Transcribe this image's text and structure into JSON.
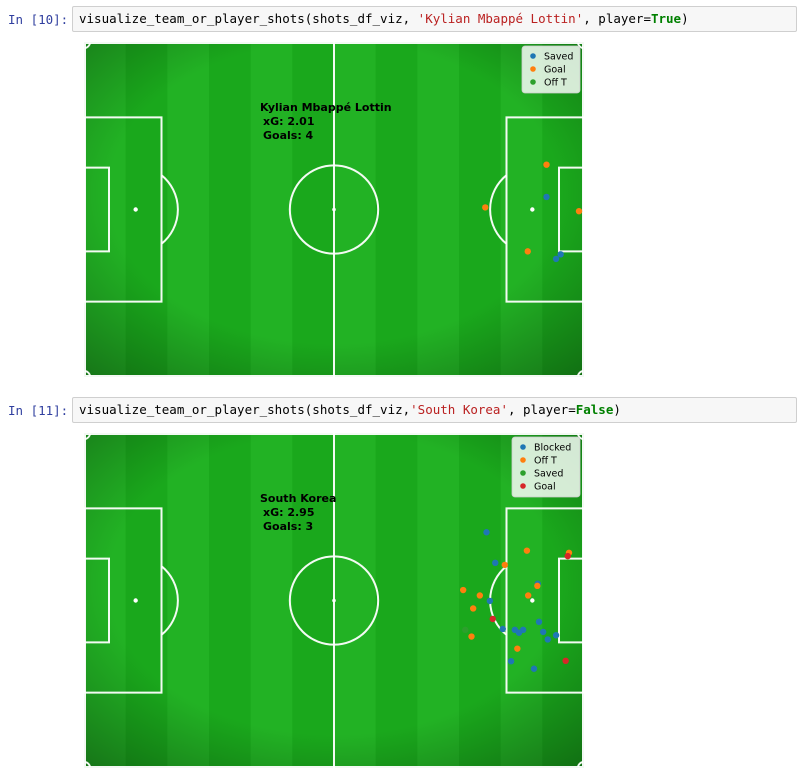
{
  "cells": [
    {
      "prompt": "In [10]:",
      "code": {
        "fn": "visualize_team_or_player_shots",
        "open": "(shots_df_viz, ",
        "arg_str": "'Kylian Mbappé Lottin'",
        "mid": ", player=",
        "kw": "True",
        "close": ")"
      },
      "annotation": {
        "name": "Kylian Mbappé Lottin",
        "xg": "xG: 2.01",
        "goals": "Goals: 4"
      },
      "legend": [
        {
          "label": "Saved",
          "color": "#1f77b4"
        },
        {
          "label": "Goal",
          "color": "#ff7f0e"
        },
        {
          "label": "Off T",
          "color": "#2ca02c"
        }
      ],
      "chart_data": {
        "type": "scatter",
        "title": "",
        "xlabel": "",
        "ylabel": "",
        "xlim": [
          0,
          120
        ],
        "ylim": [
          0,
          80
        ],
        "grid": false,
        "legend_position": "top-right",
        "series": [
          {
            "name": "Saved",
            "color": "#1f77b4",
            "x": [
              111.0,
              113.3,
              114.4
            ],
            "y": [
              43.0,
              28.2,
              29.3
            ]
          },
          {
            "name": "Goal",
            "color": "#ff7f0e",
            "x": [
              111.0,
              96.3,
              118.8,
              106.5
            ],
            "y": [
              50.7,
              40.5,
              39.6,
              30.0
            ]
          },
          {
            "name": "Off T",
            "color": "#2ca02c",
            "x": [],
            "y": []
          }
        ]
      }
    },
    {
      "prompt": "In [11]:",
      "code": {
        "fn": "visualize_team_or_player_shots",
        "open": "(shots_df_viz,",
        "arg_str": "'South Korea'",
        "mid": ", player=",
        "kw": "False",
        "close": ")"
      },
      "annotation": {
        "name": "South Korea",
        "xg": "xG: 2.95",
        "goals": "Goals: 3"
      },
      "legend": [
        {
          "label": "Blocked",
          "color": "#1f77b4"
        },
        {
          "label": "Off T",
          "color": "#ff7f0e"
        },
        {
          "label": "Saved",
          "color": "#2ca02c"
        },
        {
          "label": "Goal",
          "color": "#d62728"
        }
      ],
      "chart_data": {
        "type": "scatter",
        "title": "",
        "xlabel": "",
        "ylabel": "",
        "xlim": [
          0,
          120
        ],
        "ylim": [
          0,
          80
        ],
        "grid": false,
        "legend_position": "top-right",
        "series": [
          {
            "name": "Blocked",
            "color": "#1f77b4",
            "x": [
              96.6,
              98.7,
              97.4,
              100.5,
              103.4,
              105.4,
              104.4,
              108.9,
              109.2,
              110.2,
              113.3,
              111.3,
              108.0,
              102.5
            ],
            "y": [
              56.3,
              49.0,
              39.9,
              33.2,
              33.0,
              33.0,
              32.3,
              44.0,
              34.9,
              32.5,
              31.7,
              30.7,
              23.7,
              25.5
            ]
          },
          {
            "name": "Off T",
            "color": "#ff7f0e",
            "x": [
              101.0,
              106.3,
              116.4,
              91.0,
              93.4,
              95.0,
              108.8,
              106.6,
              104.0,
              93.0
            ],
            "y": [
              48.5,
              51.9,
              51.4,
              42.5,
              38.1,
              41.2,
              43.5,
              41.2,
              28.5,
              31.4
            ]
          },
          {
            "name": "Saved",
            "color": "#2ca02c",
            "x": [
              91.5
            ],
            "y": [
              33.0
            ]
          },
          {
            "name": "Goal",
            "color": "#d62728",
            "x": [
              116.1,
              98.1,
              115.6
            ],
            "y": [
              50.6,
              35.6,
              25.6
            ]
          }
        ]
      }
    }
  ]
}
